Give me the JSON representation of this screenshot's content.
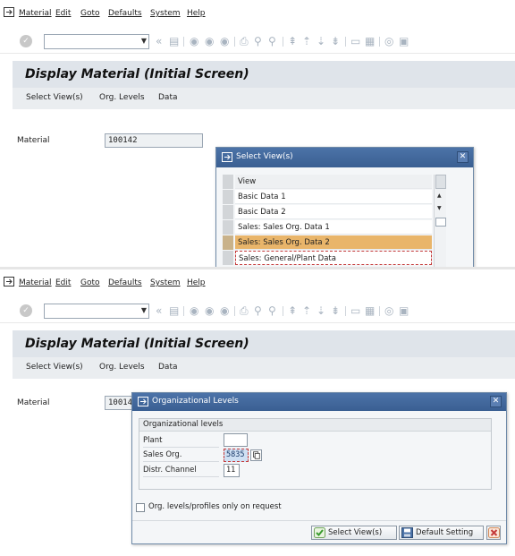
{
  "menu": [
    "Material",
    "Edit",
    "Goto",
    "Defaults",
    "System",
    "Help"
  ],
  "page_title": "Display Material (Initial Screen)",
  "app_toolbar": [
    "Select View(s)",
    "Org. Levels",
    "Data"
  ],
  "material_field": {
    "label": "Material",
    "value": "100142"
  },
  "select_views_dialog": {
    "title": "Select View(s)",
    "column_header": "View",
    "items": [
      "Basic Data 1",
      "Basic Data 2",
      "Sales: Sales Org. Data 1",
      "Sales: Sales Org. Data 2",
      "Sales: General/Plant Data"
    ],
    "selected_item": "Sales: Sales Org. Data 2"
  },
  "org_levels_dialog": {
    "title": "Organizational Levels",
    "group_title": "Organizational levels",
    "fields": [
      {
        "label": "Plant",
        "value": ""
      },
      {
        "label": "Sales Org.",
        "value": "5835"
      },
      {
        "label": "Distr. Channel",
        "value": "11"
      }
    ],
    "checkbox_label": "Org. levels/profiles only on request",
    "checkbox_checked": false,
    "buttons": {
      "select_views": "Select View(s)",
      "default_setting": "Default Setting"
    }
  },
  "colors": {
    "title_bar": "#dfe4ea",
    "dialog_header": "#3a5f92",
    "selected_row": "#e9b56a",
    "accent_check": "#3a9b2f",
    "cancel_red": "#c43a3a"
  }
}
